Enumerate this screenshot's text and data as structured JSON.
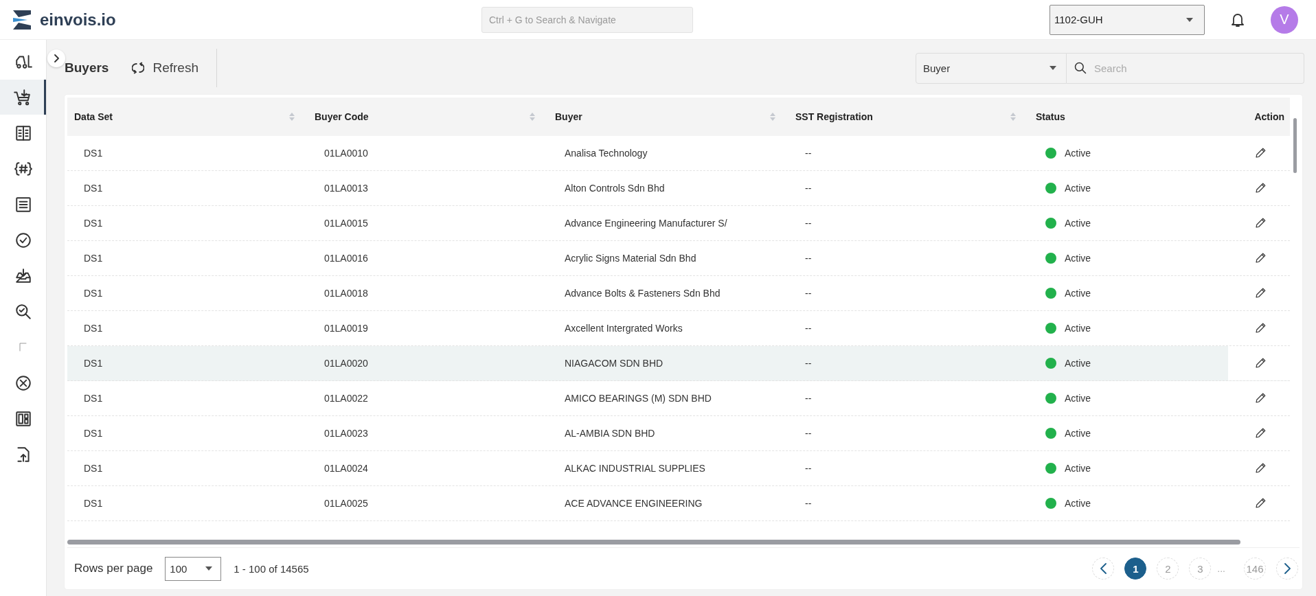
{
  "topbar": {
    "logo_text": "einvois.io",
    "search_placeholder": "Ctrl + G to Search & Navigate",
    "company": "1102-GUH",
    "avatar_initial": "V"
  },
  "sidebar": {
    "items": [
      {
        "selected": false
      },
      {
        "selected": true
      },
      {
        "selected": false
      },
      {
        "selected": false
      },
      {
        "selected": false
      },
      {
        "selected": false
      },
      {
        "selected": false
      },
      {
        "selected": false
      },
      {
        "selected": false
      },
      {
        "selected": false
      },
      {
        "selected": false
      },
      {
        "selected": false
      }
    ]
  },
  "toolbar": {
    "title": "Buyers",
    "refresh": "Refresh",
    "filter": "Buyer",
    "search_placeholder": "Search"
  },
  "table": {
    "columns": [
      {
        "label": "Data Set",
        "sortable": true
      },
      {
        "label": "Buyer Code",
        "sortable": true
      },
      {
        "label": "Buyer",
        "sortable": true
      },
      {
        "label": "SST Registration",
        "sortable": true
      },
      {
        "label": "Status",
        "sortable": false
      },
      {
        "label": "Action",
        "sortable": false
      }
    ],
    "rows": [
      {
        "data_set": "DS1",
        "buyer_code": "01LA0010",
        "buyer": "Analisa Technology",
        "sst": "--",
        "status": "Active",
        "highlighted": false
      },
      {
        "data_set": "DS1",
        "buyer_code": "01LA0013",
        "buyer": "Alton Controls Sdn Bhd",
        "sst": "--",
        "status": "Active",
        "highlighted": false
      },
      {
        "data_set": "DS1",
        "buyer_code": "01LA0015",
        "buyer": "Advance Engineering Manufacturer S/",
        "sst": "--",
        "status": "Active",
        "highlighted": false
      },
      {
        "data_set": "DS1",
        "buyer_code": "01LA0016",
        "buyer": "Acrylic Signs Material Sdn Bhd",
        "sst": "--",
        "status": "Active",
        "highlighted": false
      },
      {
        "data_set": "DS1",
        "buyer_code": "01LA0018",
        "buyer": "Advance Bolts & Fasteners Sdn Bhd",
        "sst": "--",
        "status": "Active",
        "highlighted": false
      },
      {
        "data_set": "DS1",
        "buyer_code": "01LA0019",
        "buyer": "Axcellent Intergrated Works",
        "sst": "--",
        "status": "Active",
        "highlighted": false
      },
      {
        "data_set": "DS1",
        "buyer_code": "01LA0020",
        "buyer": "NIAGACOM SDN BHD",
        "sst": "--",
        "status": "Active",
        "highlighted": true
      },
      {
        "data_set": "DS1",
        "buyer_code": "01LA0022",
        "buyer": "AMICO BEARINGS (M) SDN BHD",
        "sst": "--",
        "status": "Active",
        "highlighted": false
      },
      {
        "data_set": "DS1",
        "buyer_code": "01LA0023",
        "buyer": "AL-AMBIA SDN BHD",
        "sst": "--",
        "status": "Active",
        "highlighted": false
      },
      {
        "data_set": "DS1",
        "buyer_code": "01LA0024",
        "buyer": "ALKAC INDUSTRIAL SUPPLIES",
        "sst": "--",
        "status": "Active",
        "highlighted": false
      },
      {
        "data_set": "DS1",
        "buyer_code": "01LA0025",
        "buyer": "ACE ADVANCE ENGINEERING",
        "sst": "--",
        "status": "Active",
        "highlighted": false
      }
    ]
  },
  "pagination": {
    "rows_per_page_label": "Rows per page",
    "rows_per_page": "100",
    "range": "1 - 100 of 14565",
    "pages": [
      {
        "kind": "page",
        "label": "1",
        "selected": true
      },
      {
        "kind": "page",
        "label": "2",
        "selected": false
      },
      {
        "kind": "page",
        "label": "3",
        "selected": false
      },
      {
        "kind": "gap",
        "label": "..."
      },
      {
        "kind": "page",
        "label": "146",
        "selected": false
      }
    ]
  }
}
